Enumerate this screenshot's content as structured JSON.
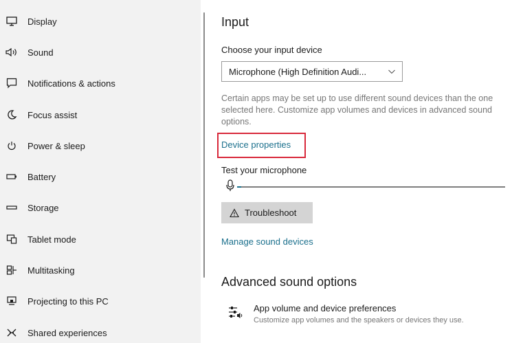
{
  "sidebar": {
    "items": [
      {
        "label": "Display",
        "icon": "display-icon"
      },
      {
        "label": "Sound",
        "icon": "sound-icon"
      },
      {
        "label": "Notifications & actions",
        "icon": "notifications-icon"
      },
      {
        "label": "Focus assist",
        "icon": "focus-assist-icon"
      },
      {
        "label": "Power & sleep",
        "icon": "power-icon"
      },
      {
        "label": "Battery",
        "icon": "battery-icon"
      },
      {
        "label": "Storage",
        "icon": "storage-icon"
      },
      {
        "label": "Tablet mode",
        "icon": "tablet-mode-icon"
      },
      {
        "label": "Multitasking",
        "icon": "multitasking-icon"
      },
      {
        "label": "Projecting to this PC",
        "icon": "projecting-icon"
      },
      {
        "label": "Shared experiences",
        "icon": "shared-experiences-icon"
      }
    ]
  },
  "input": {
    "heading": "Input",
    "choose_label": "Choose your input device",
    "device_selected": "Microphone (High Definition Audi...",
    "description": "Certain apps may be set up to use different sound devices than the one selected here. Customize app volumes and devices in advanced sound options.",
    "device_properties_link": "Device properties",
    "test_label": "Test your microphone",
    "mic_level": 0.015,
    "troubleshoot_label": "Troubleshoot",
    "manage_link": "Manage sound devices"
  },
  "advanced": {
    "heading": "Advanced sound options",
    "pref_title": "App volume and device preferences",
    "pref_desc": "Customize app volumes and the speakers or devices they use."
  },
  "colors": {
    "link": "#1a6f8c",
    "highlight": "#d8283a",
    "sidebar_bg": "#f2f2f2"
  }
}
